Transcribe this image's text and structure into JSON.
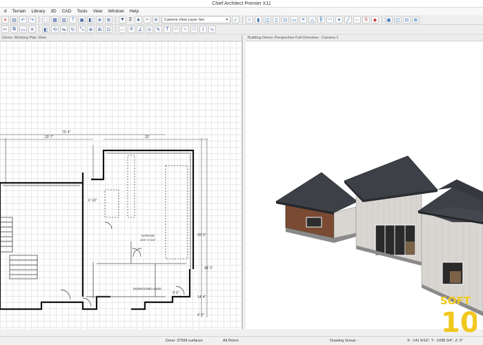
{
  "window": {
    "title": "Chief Architect Premier X11"
  },
  "menu": [
    "d",
    "Terrain",
    "Library",
    "3D",
    "CAD",
    "Tools",
    "View",
    "Window",
    "Help"
  ],
  "toolbar": {
    "floor_number": "2",
    "layer_set": "Camera View Layer Set"
  },
  "left_pane": {
    "title": "Demo: Working Plan View",
    "dims": {
      "top_total": "75' 4\"",
      "top_left": "20' 7\"",
      "top_right": "32'",
      "left_vertical": "6' 10\"",
      "right_vertical_1": "20' 0\"",
      "right_vertical_2": "48' 1\"",
      "right_vertical_3": "14' 4\"",
      "right_vertical_4": "4' 2\"",
      "mid": "9' 6\""
    },
    "rooms": {
      "garage": "GARAGE",
      "garage_dims": "24'8\" X 24'8\"",
      "mudroom": "MUDROOM/LAUND"
    }
  },
  "right_pane": {
    "title": "Building Demo: Perspective Full Overview - Camera 1"
  },
  "status": {
    "done": "Done:  37599 surfaces",
    "floors": "All Floors",
    "drawing_group": "Drawing Group: -",
    "coords": "X: -141 9/16\", Y: -1098 3/4\", Z: 0\""
  },
  "watermark": {
    "line1": "SOFT",
    "line2": "10"
  },
  "colors": {
    "roof": "#3d4046",
    "brick": "#7a4a32",
    "siding": "#d8d6d2",
    "accent": "#f2c81f"
  }
}
